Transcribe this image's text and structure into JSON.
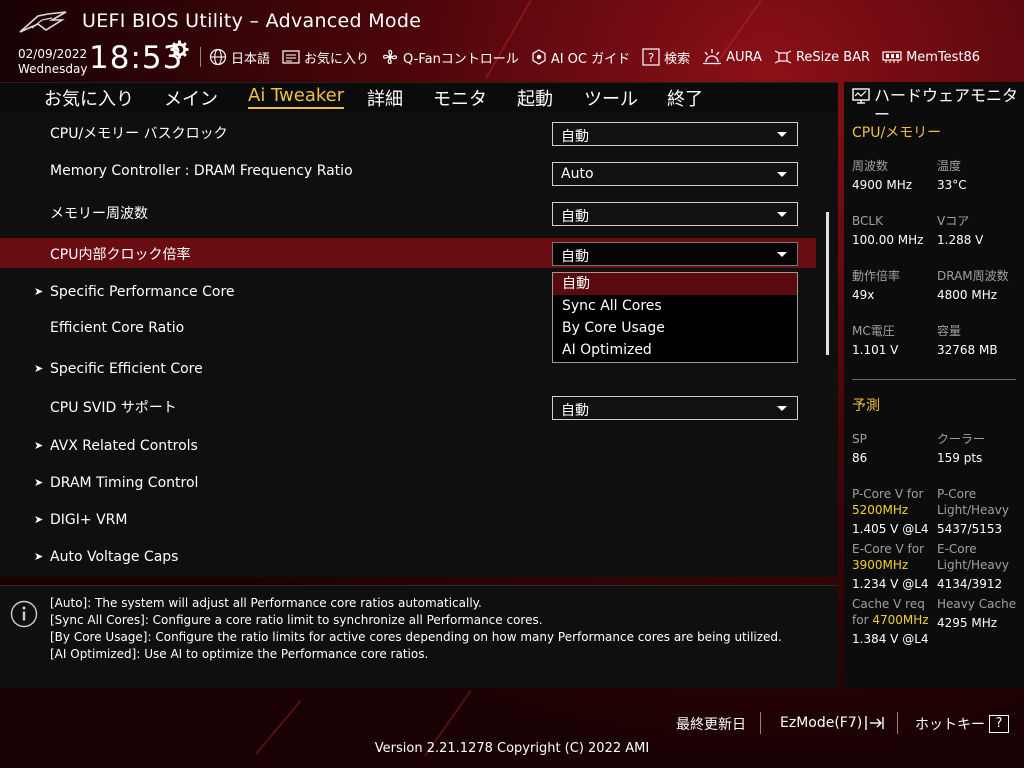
{
  "header": {
    "title": "UEFI BIOS Utility – Advanced Mode",
    "date": "02/09/2022",
    "weekday": "Wednesday",
    "time": "18:53",
    "toolbar": [
      {
        "label": "日本語",
        "icon": "globe-icon"
      },
      {
        "label": "お気に入り",
        "icon": "favorites-icon"
      },
      {
        "label": "Q-Fanコントロール",
        "icon": "fan-icon"
      },
      {
        "label": "AI OC ガイド",
        "icon": "ai-oc-icon"
      },
      {
        "label": "検索",
        "icon": "search-help-icon"
      },
      {
        "label": "AURA",
        "icon": "aura-icon"
      },
      {
        "label": "ReSize BAR",
        "icon": "resize-bar-icon"
      },
      {
        "label": "MemTest86",
        "icon": "memtest-icon"
      }
    ]
  },
  "menu": {
    "items": [
      "お気に入り",
      "メイン",
      "Ai Tweaker",
      "詳細",
      "モニタ",
      "起動",
      "ツール",
      "終了"
    ],
    "active": "Ai Tweaker"
  },
  "settings": [
    {
      "label": "CPU/メモリー バスクロック",
      "value": "自動"
    },
    {
      "label": "Memory Controller : DRAM Frequency Ratio",
      "value": "Auto"
    },
    {
      "label": "メモリー周波数",
      "value": "自動"
    },
    {
      "label": "CPU内部クロック倍率",
      "value": "自動"
    },
    {
      "label": "Specific Performance Core"
    },
    {
      "label": "Efficient Core Ratio"
    },
    {
      "label": "Specific Efficient Core"
    },
    {
      "label": "CPU SVID サポート",
      "value": "自動"
    },
    {
      "label": "AVX Related Controls"
    },
    {
      "label": "DRAM Timing Control"
    },
    {
      "label": "DIGI+ VRM"
    },
    {
      "label": "Auto Voltage Caps"
    }
  ],
  "popup_options": [
    "自動",
    "Sync All Cores",
    "By Core Usage",
    "AI Optimized"
  ],
  "popup_selected": "自動",
  "help": [
    "[Auto]: The system will adjust all Performance core ratios automatically.",
    "[Sync All Cores]: Configure a core ratio limit to synchronize all Performance cores.",
    "[By Core Usage]: Configure the ratio limits for active cores depending on how many Performance cores are being utilized.",
    "[AI Optimized]: Use AI to optimize the Performance core ratios."
  ],
  "hw_monitor": {
    "title": "ハードウェアモニター",
    "cpu_section": "CPU/メモリー",
    "cpu": [
      {
        "label": "周波数",
        "value": "4900 MHz"
      },
      {
        "label": "温度",
        "value": "33°C"
      },
      {
        "label": "BCLK",
        "value": "100.00 MHz"
      },
      {
        "label": "Vコア",
        "value": "1.288 V"
      },
      {
        "label": "動作倍率",
        "value": "49x"
      },
      {
        "label": "DRAM周波数",
        "value": "4800 MHz"
      },
      {
        "label": "MC電圧",
        "value": "1.101 V"
      },
      {
        "label": "容量",
        "value": "32768 MB"
      }
    ],
    "predict_section": "予測",
    "predict": {
      "sp_label": "SP",
      "sp_value": "86",
      "cooler_label": "クーラー",
      "cooler_value": "159 pts",
      "pcore_v_label": "P-Core V for",
      "pcore_v_freq": "5200MHz",
      "pcore_v_value": "1.405 V @L4",
      "pcore_lh_label_1": "P-Core",
      "pcore_lh_label_2": "Light/Heavy",
      "pcore_lh_value": "5437/5153",
      "ecore_v_label": "E-Core V for",
      "ecore_v_freq": "3900MHz",
      "ecore_v_value": "1.234 V @L4",
      "ecore_lh_label_1": "E-Core",
      "ecore_lh_label_2": "Light/Heavy",
      "ecore_lh_value": "4134/3912",
      "cache_label_1": "Cache V req",
      "cache_label_2": "for",
      "cache_freq": "4700MHz",
      "cache_value": "1.384 V @L4",
      "heavy_cache_label": "Heavy Cache",
      "heavy_cache_value": "4295 MHz"
    }
  },
  "footer": {
    "last_modified": "最終更新日",
    "ezmode": "EzMode(F7)",
    "hotkeys": "ホットキー",
    "hotkey_glyph": "?",
    "version": "Version 2.21.1278 Copyright (C) 2022 AMI"
  },
  "colors": {
    "accent": "#f0c040",
    "selected_row": "#6a0d12",
    "background_red": "#8c1018"
  }
}
